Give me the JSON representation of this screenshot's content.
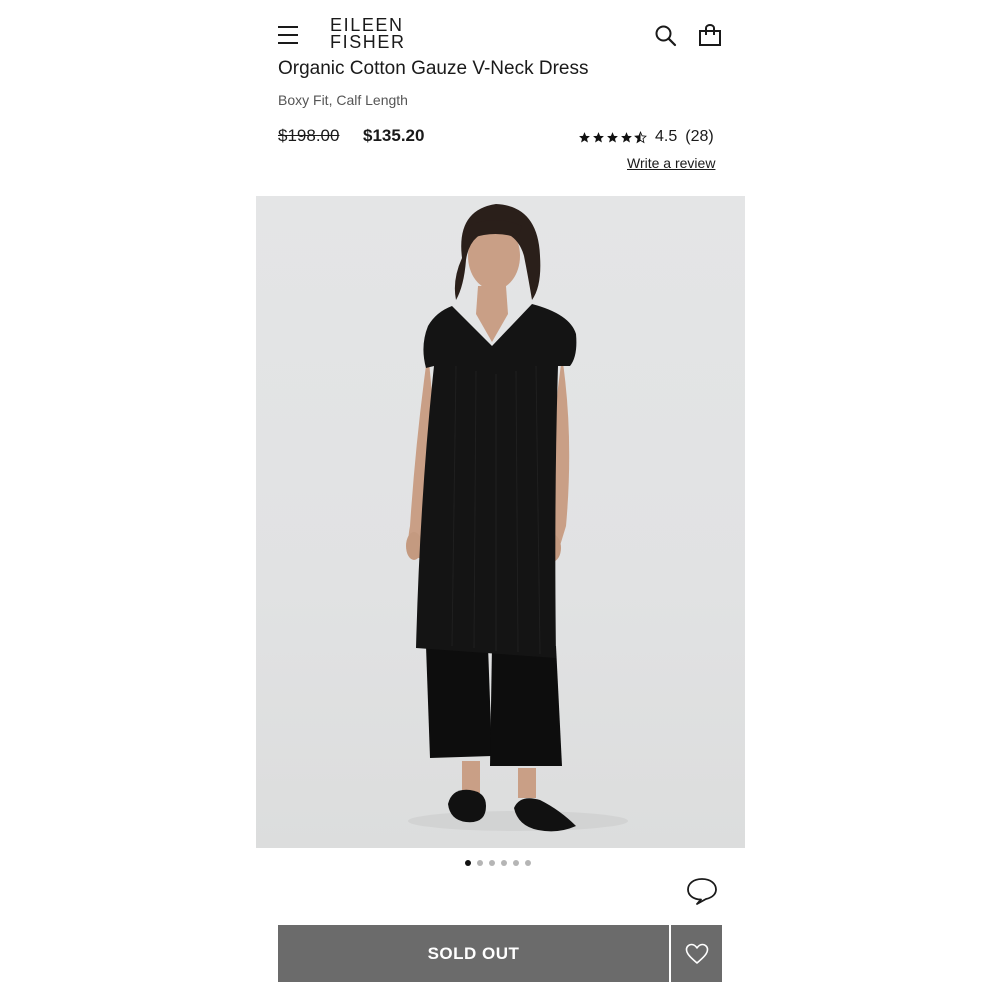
{
  "header": {
    "logo_line1": "EILEEN",
    "logo_line2": "FISHER",
    "menu_icon": "hamburger-menu-icon",
    "search_icon": "search-icon",
    "bag_icon": "shopping-bag-icon"
  },
  "product": {
    "title": "Organic Cotton Gauze V-Neck Dress",
    "subtitle": "Boxy Fit, Calf Length",
    "price_original": "$198.00",
    "price_sale": "$135.20",
    "rating_value": "4.5",
    "rating_count": "(28)",
    "rating_stars": 4.5,
    "review_link": "Write a review"
  },
  "gallery": {
    "total_images": 6,
    "active_index": 0
  },
  "actions": {
    "primary_label": "SOLD OUT",
    "wishlist_icon": "heart-icon",
    "chat_icon": "chat-bubble-icon"
  },
  "colors": {
    "primary_button": "#6b6b6b",
    "text": "#1a1a1a",
    "image_background": "#e2e3e4"
  }
}
